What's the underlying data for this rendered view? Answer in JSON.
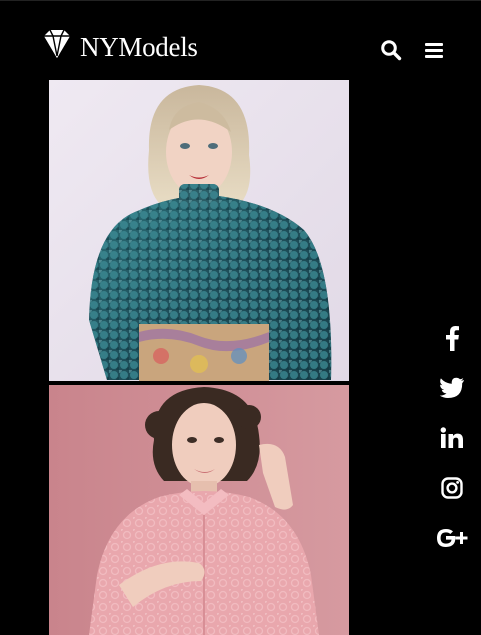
{
  "header": {
    "brand": "NYModels",
    "icons": {
      "logo": "diamond-logo-icon",
      "search": "search-icon",
      "menu": "hamburger-menu-icon"
    }
  },
  "gallery": [
    {
      "alt_hint": "model-in-teal-sequin-top",
      "icon": "photo"
    },
    {
      "alt_hint": "model-in-pink-lace-dress",
      "icon": "photo"
    }
  ],
  "social": [
    {
      "network": "facebook",
      "glyph": "f"
    },
    {
      "network": "twitter",
      "glyph": "twitter-bird"
    },
    {
      "network": "linkedin",
      "glyph": "in"
    },
    {
      "network": "instagram",
      "glyph": "instagram-camera"
    },
    {
      "network": "google-plus",
      "glyph": "G+"
    }
  ],
  "colors": {
    "background": "#000000",
    "foreground": "#ffffff"
  }
}
